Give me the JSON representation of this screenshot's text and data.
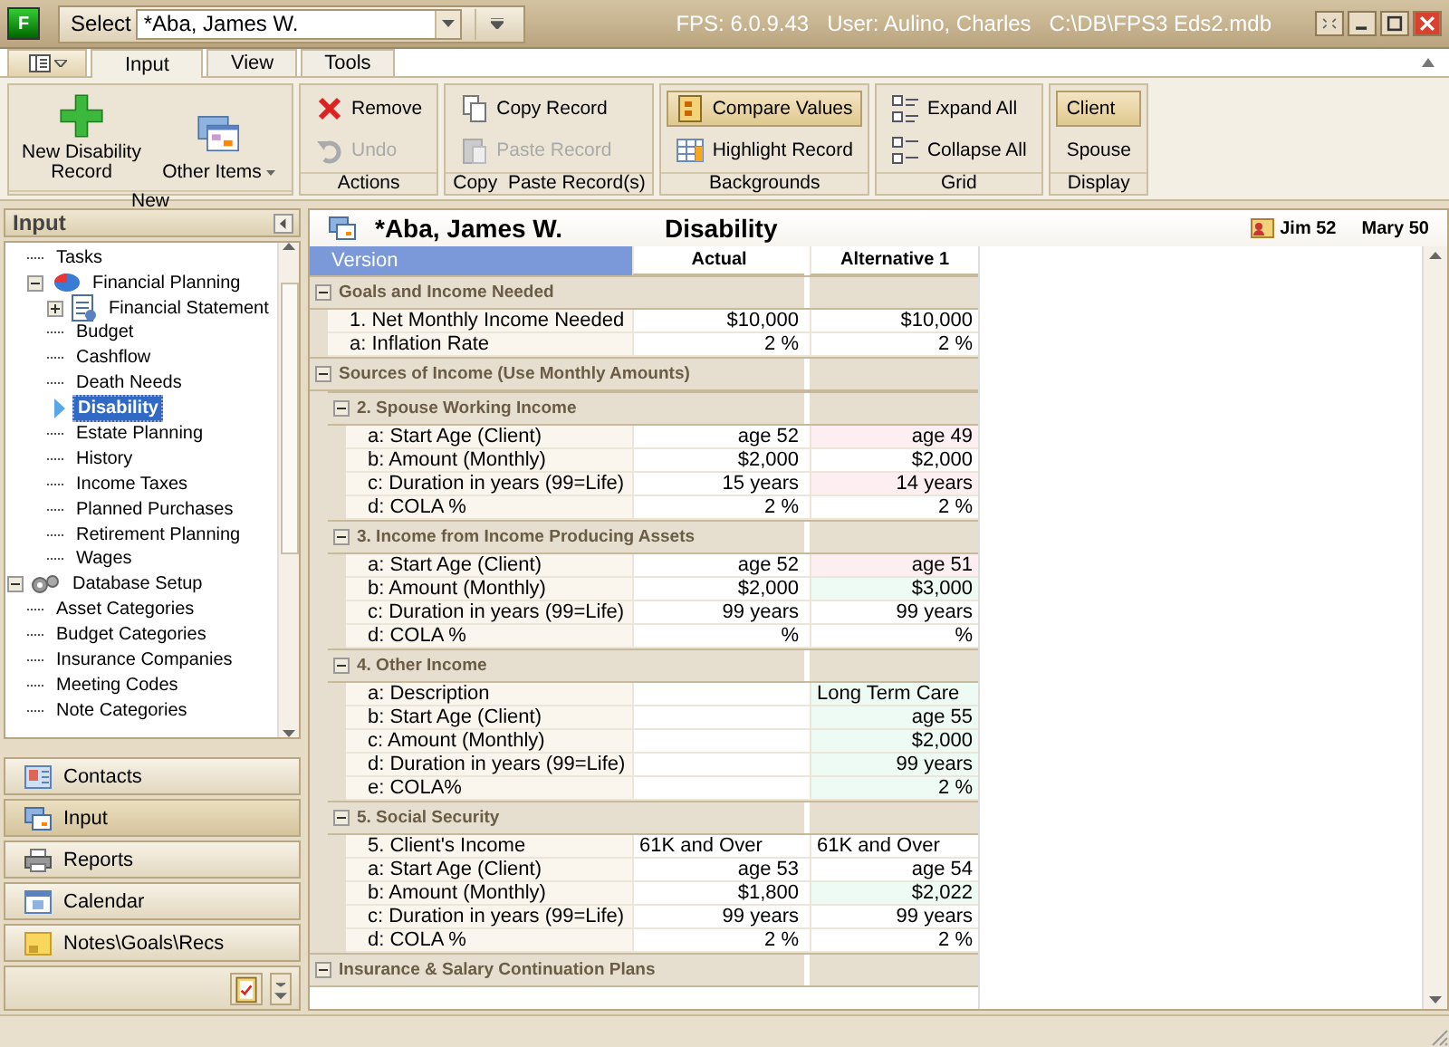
{
  "titlebar": {
    "logo_letter": "F",
    "select_label": "Select",
    "select_value": "*Aba, James W.",
    "title": "FPS: 6.0.9.43   User: Aulino, Charles   C:\\DB\\FPS3 Eds2.mdb"
  },
  "ribbon": {
    "tabs": [
      {
        "label": "Input",
        "selected": true
      },
      {
        "label": "View",
        "selected": false
      },
      {
        "label": "Tools",
        "selected": false
      }
    ],
    "groups": [
      {
        "label": "New",
        "buttons": [
          {
            "label": "New Disability Record",
            "kind": "large",
            "dropdown": false,
            "disabled": false,
            "pressed": false
          },
          {
            "label": "Other Items",
            "kind": "large",
            "dropdown": true,
            "disabled": false,
            "pressed": false
          }
        ]
      },
      {
        "label": "Actions",
        "buttons": [
          {
            "label": "Remove",
            "kind": "small",
            "dropdown": false,
            "disabled": false,
            "pressed": false
          },
          {
            "label": "Undo",
            "kind": "small",
            "dropdown": false,
            "disabled": true,
            "pressed": false
          }
        ]
      },
      {
        "label": "Copy  Paste Record(s)",
        "buttons": [
          {
            "label": "Copy Record",
            "kind": "small",
            "dropdown": false,
            "disabled": false,
            "pressed": false
          },
          {
            "label": "Paste Record",
            "kind": "small",
            "dropdown": false,
            "disabled": true,
            "pressed": false
          }
        ]
      },
      {
        "label": "Backgrounds",
        "buttons": [
          {
            "label": "Compare Values",
            "kind": "small",
            "dropdown": false,
            "disabled": false,
            "pressed": true
          },
          {
            "label": "Highlight Record",
            "kind": "small",
            "dropdown": false,
            "disabled": false,
            "pressed": false
          }
        ]
      },
      {
        "label": "Grid",
        "buttons": [
          {
            "label": "Expand All",
            "kind": "small",
            "dropdown": false,
            "disabled": false,
            "pressed": false
          },
          {
            "label": "Collapse All",
            "kind": "small",
            "dropdown": false,
            "disabled": false,
            "pressed": false
          }
        ]
      },
      {
        "label": "Display",
        "buttons": [
          {
            "label": "Client",
            "kind": "text",
            "dropdown": false,
            "disabled": false,
            "pressed": true
          },
          {
            "label": "Spouse",
            "kind": "text",
            "dropdown": false,
            "disabled": false,
            "pressed": false
          }
        ]
      }
    ]
  },
  "sidebar": {
    "title": "Input",
    "tree": [
      {
        "kind": "hidden",
        "children": [
          {
            "label": "Tasks",
            "kind": "leaf",
            "selected": false
          },
          {
            "label": "Financial Planning",
            "kind": "folder",
            "expanded": true,
            "selected": false,
            "children": [
              {
                "label": "Financial Statement",
                "kind": "folder",
                "expanded": false,
                "selected": false
              },
              {
                "label": "Budget",
                "kind": "leaf",
                "selected": false
              },
              {
                "label": "Cashflow",
                "kind": "leaf",
                "selected": false
              },
              {
                "label": "Death Needs",
                "kind": "leaf",
                "selected": false
              },
              {
                "label": "Disability",
                "kind": "leaf",
                "selected": true
              },
              {
                "label": "Estate Planning",
                "kind": "leaf",
                "selected": false
              },
              {
                "label": "History",
                "kind": "leaf",
                "selected": false
              },
              {
                "label": "Income Taxes",
                "kind": "leaf",
                "selected": false
              },
              {
                "label": "Planned Purchases",
                "kind": "leaf",
                "selected": false
              },
              {
                "label": "Retirement Planning",
                "kind": "leaf",
                "selected": false
              },
              {
                "label": "Wages",
                "kind": "leaf",
                "selected": false
              }
            ]
          }
        ]
      },
      {
        "label": "Database Setup",
        "kind": "folder",
        "expanded": true,
        "selected": false,
        "children": [
          {
            "label": "Asset Categories",
            "kind": "leaf",
            "selected": false
          },
          {
            "label": "Budget Categories",
            "kind": "leaf",
            "selected": false
          },
          {
            "label": "Insurance Companies",
            "kind": "leaf",
            "selected": false
          },
          {
            "label": "Meeting Codes",
            "kind": "leaf",
            "selected": false
          },
          {
            "label": "Note Categories",
            "kind": "leaf",
            "selected": false
          }
        ]
      }
    ],
    "nav": [
      {
        "label": "Contacts",
        "selected": false
      },
      {
        "label": "Input",
        "selected": true
      },
      {
        "label": "Reports",
        "selected": false
      },
      {
        "label": "Calendar",
        "selected": false
      },
      {
        "label": "Notes\\Goals\\Recs",
        "selected": false
      }
    ]
  },
  "record": {
    "client": "*Aba, James W.",
    "module": "Disability",
    "people": [
      "Jim 52",
      "Mary 50"
    ]
  },
  "grid": {
    "version_label": "Version",
    "columns": [
      "Actual",
      "Alternative 1"
    ],
    "items": [
      {
        "kind": "section",
        "title": "Goals and Income Needed",
        "expanded": true,
        "children": [
          {
            "kind": "value",
            "label": "1. Net Monthly Income Needed",
            "cells": [
              {
                "text": "$10,000",
                "changed": false,
                "added": false
              },
              {
                "text": "$10,000",
                "changed": false,
                "added": false
              }
            ]
          },
          {
            "kind": "value",
            "label": "a: Inflation Rate",
            "cells": [
              {
                "text": "2 %",
                "changed": false,
                "added": false
              },
              {
                "text": "2 %",
                "changed": false,
                "added": false
              }
            ]
          }
        ]
      },
      {
        "kind": "section",
        "title": "Sources of Income  (Use Monthly Amounts)",
        "expanded": true,
        "children": [
          {
            "kind": "section",
            "title": "2. Spouse Working Income",
            "expanded": true,
            "children": [
              {
                "kind": "value",
                "label": "a: Start Age (Client)",
                "cells": [
                  {
                    "text": "age 52",
                    "changed": false,
                    "added": false
                  },
                  {
                    "text": "age 49",
                    "changed": true,
                    "added": false
                  }
                ]
              },
              {
                "kind": "value",
                "label": "b: Amount (Monthly)",
                "cells": [
                  {
                    "text": "$2,000",
                    "changed": false,
                    "added": false
                  },
                  {
                    "text": "$2,000",
                    "changed": false,
                    "added": false
                  }
                ]
              },
              {
                "kind": "value",
                "label": "c: Duration in years (99=Life)",
                "cells": [
                  {
                    "text": "15 years",
                    "changed": false,
                    "added": false
                  },
                  {
                    "text": "14 years",
                    "changed": true,
                    "added": false
                  }
                ]
              },
              {
                "kind": "value",
                "label": "d: COLA %",
                "cells": [
                  {
                    "text": "2 %",
                    "changed": false,
                    "added": false
                  },
                  {
                    "text": "2 %",
                    "changed": false,
                    "added": false
                  }
                ]
              }
            ]
          },
          {
            "kind": "section",
            "title": "3. Income from Income Producing Assets",
            "expanded": true,
            "children": [
              {
                "kind": "value",
                "label": "a: Start Age (Client)",
                "cells": [
                  {
                    "text": "age 52",
                    "changed": false,
                    "added": false
                  },
                  {
                    "text": "age 51",
                    "changed": true,
                    "added": false
                  }
                ]
              },
              {
                "kind": "value",
                "label": "b: Amount (Monthly)",
                "cells": [
                  {
                    "text": "$2,000",
                    "changed": false,
                    "added": false
                  },
                  {
                    "text": "$3,000",
                    "changed": false,
                    "added": true
                  }
                ]
              },
              {
                "kind": "value",
                "label": "c: Duration in years (99=Life)",
                "cells": [
                  {
                    "text": "99 years",
                    "changed": false,
                    "added": false
                  },
                  {
                    "text": "99 years",
                    "changed": false,
                    "added": false
                  }
                ]
              },
              {
                "kind": "value",
                "label": "d: COLA %",
                "cells": [
                  {
                    "text": "%",
                    "changed": false,
                    "added": false
                  },
                  {
                    "text": "%",
                    "changed": false,
                    "added": false
                  }
                ]
              }
            ]
          },
          {
            "kind": "section",
            "title": "4. Other Income",
            "expanded": true,
            "children": [
              {
                "kind": "text",
                "label": "a: Description",
                "cells": [
                  null,
                  {
                    "text": "Long Term Care",
                    "changed": false,
                    "added": true
                  }
                ]
              },
              {
                "kind": "value",
                "label": "b: Start Age (Client)",
                "cells": [
                  null,
                  {
                    "text": "age 55",
                    "changed": false,
                    "added": true
                  }
                ]
              },
              {
                "kind": "value",
                "label": "c: Amount (Monthly)",
                "cells": [
                  null,
                  {
                    "text": "$2,000",
                    "changed": false,
                    "added": true
                  }
                ]
              },
              {
                "kind": "value",
                "label": "d: Duration in years (99=Life)",
                "cells": [
                  null,
                  {
                    "text": "99 years",
                    "changed": false,
                    "added": true
                  }
                ]
              },
              {
                "kind": "value",
                "label": "e: COLA%",
                "cells": [
                  null,
                  {
                    "text": "2 %",
                    "changed": false,
                    "added": true
                  }
                ]
              }
            ]
          },
          {
            "kind": "section",
            "title": "5. Social Security",
            "expanded": true,
            "children": [
              {
                "kind": "text",
                "label": "5. Client's Income",
                "cells": [
                  {
                    "text": "61K and Over",
                    "changed": false,
                    "added": false
                  },
                  {
                    "text": "61K and Over",
                    "changed": false,
                    "added": false
                  }
                ]
              },
              {
                "kind": "value",
                "label": "a: Start Age (Client)",
                "cells": [
                  {
                    "text": "age 53",
                    "changed": false,
                    "added": false
                  },
                  {
                    "text": "age 54",
                    "changed": false,
                    "added": false
                  }
                ]
              },
              {
                "kind": "value",
                "label": "b: Amount (Monthly)",
                "cells": [
                  {
                    "text": "$1,800",
                    "changed": false,
                    "added": false
                  },
                  {
                    "text": "$2,022",
                    "changed": false,
                    "added": true
                  }
                ]
              },
              {
                "kind": "value",
                "label": "c: Duration in years (99=Life)",
                "cells": [
                  {
                    "text": "99 years",
                    "changed": false,
                    "added": false
                  },
                  {
                    "text": "99 years",
                    "changed": false,
                    "added": false
                  }
                ]
              },
              {
                "kind": "value",
                "label": "d: COLA %",
                "cells": [
                  {
                    "text": "2 %",
                    "changed": false,
                    "added": false
                  },
                  {
                    "text": "2 %",
                    "changed": false,
                    "added": false
                  }
                ]
              }
            ]
          }
        ]
      },
      {
        "kind": "section",
        "title": "Insurance & Salary Continuation Plans",
        "expanded": true
      }
    ]
  }
}
